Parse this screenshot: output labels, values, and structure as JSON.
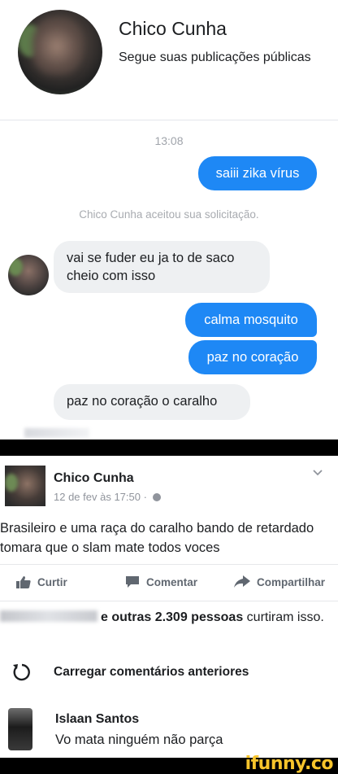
{
  "messenger": {
    "profile_name": "Chico Cunha",
    "profile_subtitle": "Segue suas publicações públicas",
    "timestamp": "13:08",
    "system_message": "Chico Cunha aceitou sua solicitação.",
    "messages": [
      {
        "from": "me",
        "text": "saiii zika vírus"
      },
      {
        "from": "them",
        "text": "vai se fuder eu ja to de saco cheio com isso"
      },
      {
        "from": "me",
        "text": "calma mosquito"
      },
      {
        "from": "me",
        "text": "paz no coração"
      },
      {
        "from": "them",
        "text": "paz no coração o caralho"
      }
    ],
    "colors": {
      "outgoing": "#1e88f5",
      "incoming": "#eef0f2"
    }
  },
  "post": {
    "author": "Chico Cunha",
    "meta": "12 de fev às 17:50 ·",
    "text": "Brasileiro e uma raça do caralho bando de retardado tomara que o slam mate todos voces",
    "actions": {
      "like": "Curtir",
      "comment": "Comentar",
      "share": "Compartilhar"
    },
    "likes_suffix": "e outras 2.309 pessoas",
    "likes_end": "curtiram isso.",
    "load_more": "Carregar comentários anteriores",
    "comment": {
      "author": "Islaan Santos",
      "text": "Vo mata ninguém não parça"
    }
  },
  "watermark": "ifunny.co"
}
